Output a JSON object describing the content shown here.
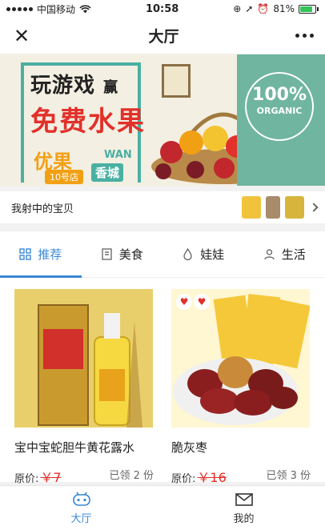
{
  "status_bar": {
    "carrier": "中国移动",
    "time": "10:58",
    "battery": "81%",
    "battery_level": 0.81
  },
  "nav": {
    "title": "大厅"
  },
  "banner": {
    "line1": "玩游戏",
    "line1_suffix": "赢",
    "line2": "免费水果",
    "brand": "优果",
    "store": "10号店",
    "wan": "WAN",
    "city": "香城",
    "organic_big": "100%",
    "organic_small": "ORGANIC"
  },
  "treasure": {
    "label": "我射中的宝贝"
  },
  "tabs": [
    {
      "label": "推荐",
      "icon": "grid-icon",
      "active": true
    },
    {
      "label": "美食",
      "icon": "food-icon",
      "active": false
    },
    {
      "label": "娃娃",
      "icon": "flame-icon",
      "active": false
    },
    {
      "label": "生活",
      "icon": "person-icon",
      "active": false
    }
  ],
  "products": [
    {
      "name": "宝中宝蛇胆牛黄花露水",
      "price_label": "原价:",
      "price": "￥7",
      "claimed": "已领 2 份"
    },
    {
      "name": "脆灰枣",
      "price_label": "原价:",
      "price": "￥16",
      "claimed": "已领 3 份"
    }
  ],
  "tabbar": [
    {
      "label": "大厅",
      "icon": "game-controller-icon",
      "active": true
    },
    {
      "label": "我的",
      "icon": "mail-icon",
      "active": false
    }
  ],
  "colors": {
    "accent": "#3a88d6",
    "price_red": "#e2302a",
    "teal": "#4ab0a2",
    "orange": "#f2a013"
  }
}
